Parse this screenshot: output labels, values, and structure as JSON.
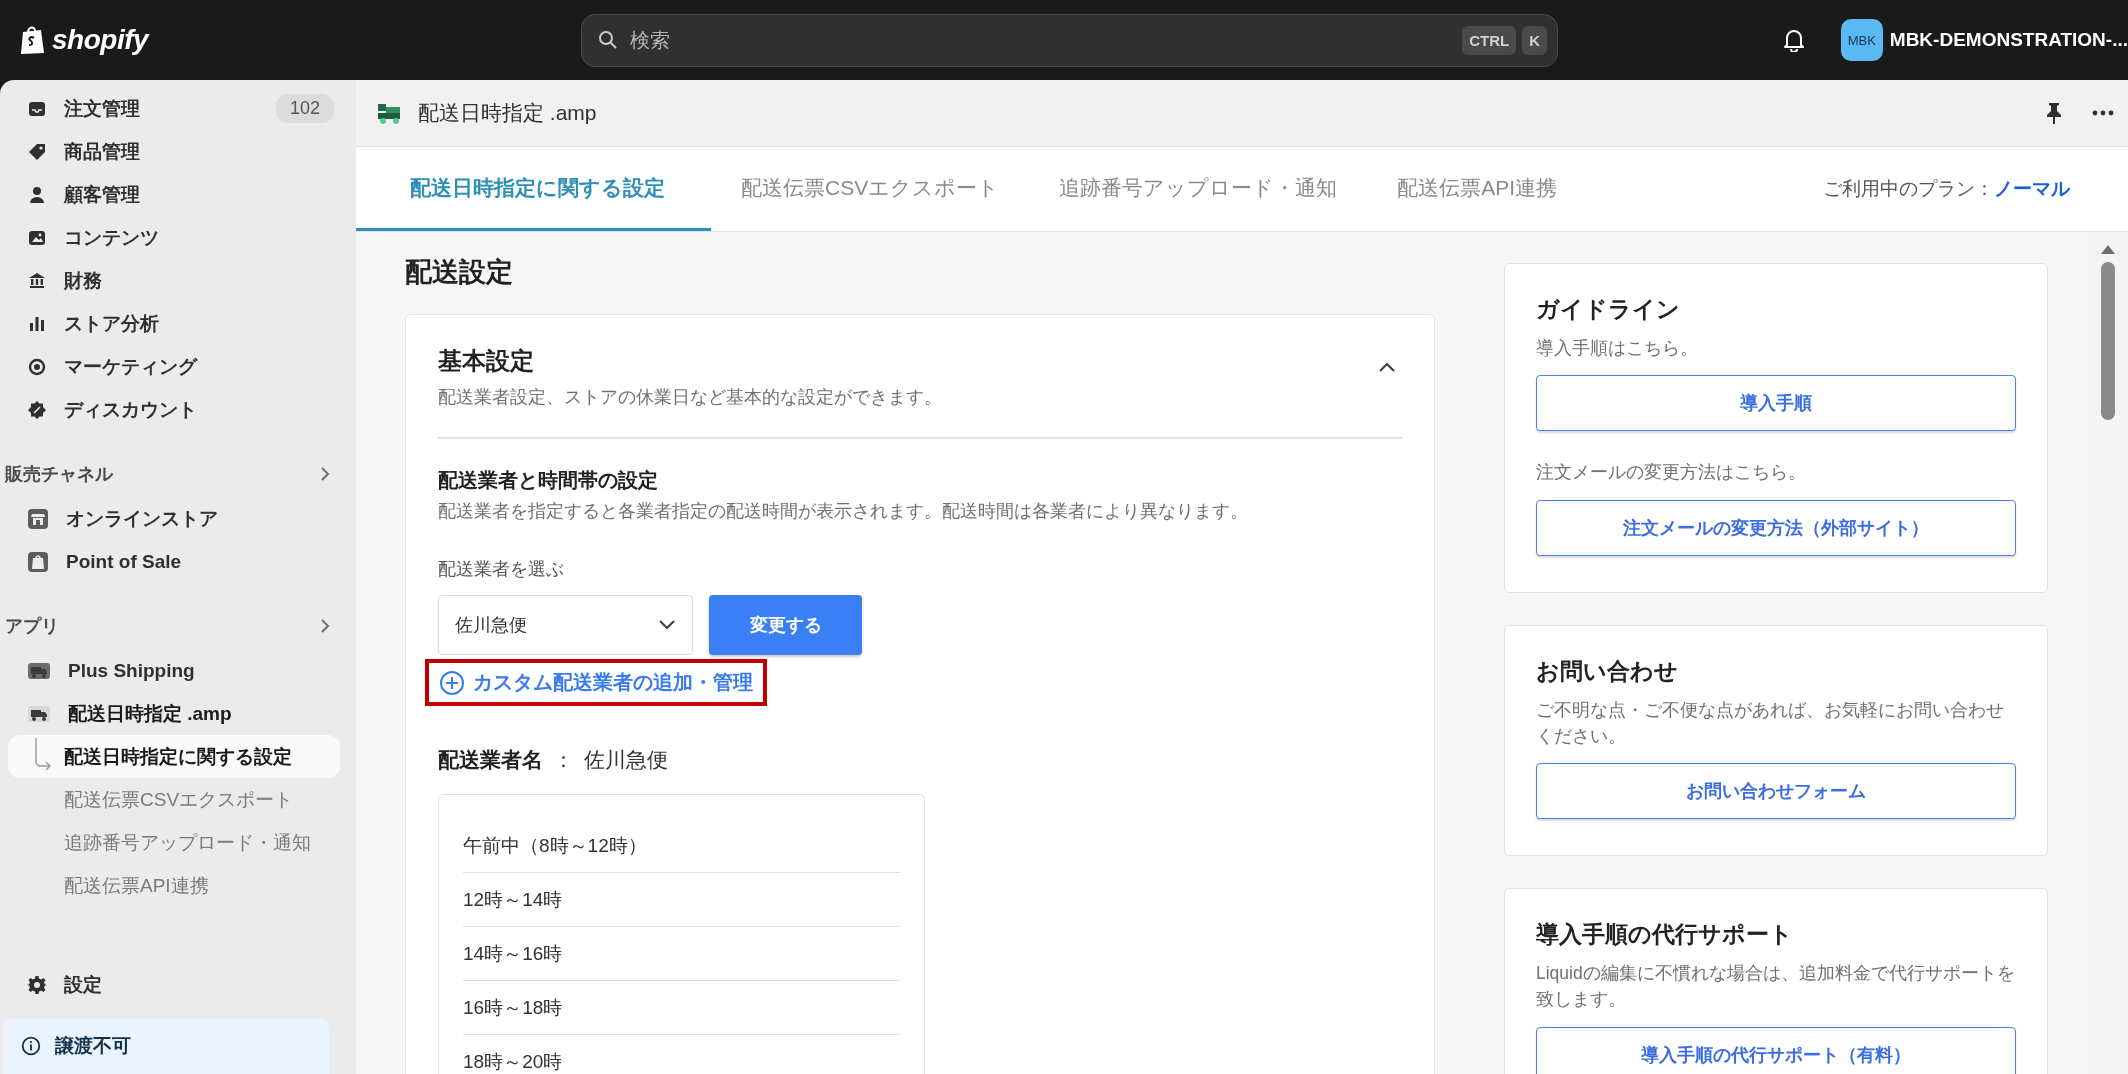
{
  "topbar": {
    "logo": "shopify",
    "search": {
      "placeholder": "検索",
      "keys": [
        "CTRL",
        "K"
      ]
    },
    "account": {
      "avatar": "MBK",
      "name": "MBK-DEMONSTRATION-..."
    }
  },
  "sidebar": {
    "items": [
      {
        "label": "注文管理",
        "badge": "102"
      },
      {
        "label": "商品管理"
      },
      {
        "label": "顧客管理"
      },
      {
        "label": "コンテンツ"
      },
      {
        "label": "財務"
      },
      {
        "label": "ストア分析"
      },
      {
        "label": "マーケティング"
      },
      {
        "label": "ディスカウント"
      }
    ],
    "sections": [
      {
        "title": "販売チャネル",
        "items": [
          {
            "label": "オンラインストア",
            "expanded": false
          },
          {
            "label": "Point of Sale",
            "expanded": false
          }
        ]
      },
      {
        "title": "アプリ",
        "items": [
          {
            "label": "Plus Shipping",
            "expanded": false
          },
          {
            "label": "配送日時指定 .amp",
            "expanded": true,
            "children": [
              {
                "label": "配送日時指定に関する設定",
                "selected": true
              },
              {
                "label": "配送伝票CSVエクスポート",
                "selected": false
              },
              {
                "label": "追跡番号アップロード・通知",
                "selected": false
              },
              {
                "label": "配送伝票API連携",
                "selected": false
              }
            ]
          }
        ]
      }
    ],
    "settings": "設定",
    "notice": "譲渡不可"
  },
  "app_header": {
    "title": "配送日時指定 .amp"
  },
  "tabs": [
    {
      "label": "配送日時指定に関する設定",
      "selected": true
    },
    {
      "label": "配送伝票CSVエクスポート",
      "selected": false
    },
    {
      "label": "追跡番号アップロード・通知",
      "selected": false
    },
    {
      "label": "配送伝票API連携",
      "selected": false
    }
  ],
  "plan": {
    "label": "ご利用中のプラン：",
    "value": "ノーマル"
  },
  "page_title": "配送設定",
  "settings_card": {
    "title": "基本設定",
    "description": "配送業者設定、ストアの休業日など基本的な設定ができます。",
    "expanded": true,
    "section": {
      "title": "配送業者と時間帯の設定",
      "description": "配送業者を指定すると各業者指定の配送時間が表示されます。配送時間は各業者により異なります。",
      "field_label": "配送業者を選ぶ",
      "select_value": "佐川急便",
      "button": "変更する",
      "custom_link": {
        "label": "カスタム配送業者の追加・管理",
        "highlighted": true
      },
      "carrier": {
        "label": "配送業者名",
        "separator": "：",
        "value": "佐川急便"
      },
      "time_slots": [
        "午前中（8時～12時）",
        "12時～14時",
        "14時～16時",
        "16時～18時",
        "18時～20時"
      ]
    }
  },
  "side_cards": [
    {
      "title": "ガイドライン",
      "blocks": [
        {
          "text": "導入手順はこちら。",
          "button": "導入手順"
        },
        {
          "text": "注文メールの変更方法はこちら。",
          "button": "注文メールの変更方法（外部サイト）"
        }
      ]
    },
    {
      "title": "お問い合わせ",
      "blocks": [
        {
          "text": "ご不明な点・ご不便な点があれば、お気軽にお問い合わせください。",
          "button": "お問い合わせフォーム"
        }
      ]
    },
    {
      "title": "導入手順の代行サポート",
      "blocks": [
        {
          "text": "Liquidの編集に不慣れな場合は、追加料金で代行サポートを致します。",
          "button": "導入手順の代行サポート（有料）"
        }
      ]
    }
  ]
}
